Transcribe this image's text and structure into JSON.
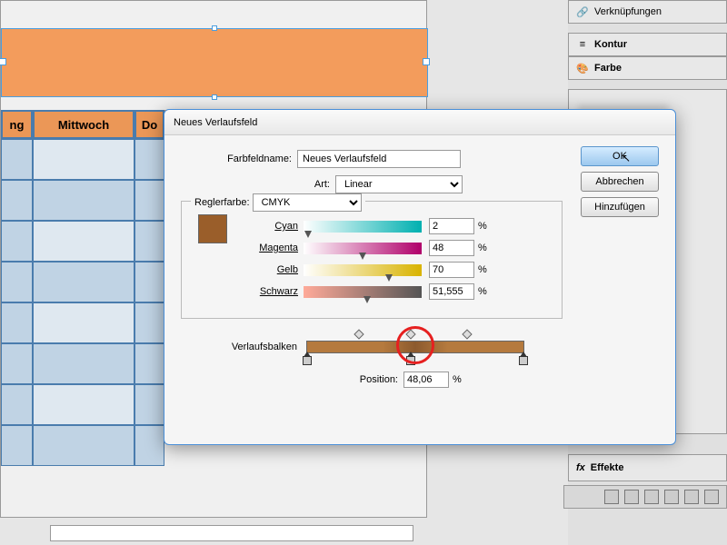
{
  "spreadsheet": {
    "headers": [
      "ng",
      "Mittwoch",
      "Do"
    ]
  },
  "right_panels": {
    "linked": "Verknüpfungen",
    "kontur": "Kontur",
    "farbe": "Farbe",
    "effekte": "Effekte",
    "fx_label": "fx"
  },
  "dialog": {
    "title": "Neues Verlaufsfeld",
    "name_label": "Farbfeldname:",
    "name_value": "Neues Verlaufsfeld",
    "type_label": "Art:",
    "type_value": "Linear",
    "regcolor_label": "Reglerfarbe:",
    "regcolor_value": "CMYK",
    "colors": {
      "cyan_label": "Cyan",
      "cyan_val": "2",
      "magenta_label": "Magenta",
      "magenta_val": "48",
      "yellow_label": "Gelb",
      "yellow_val": "70",
      "black_label": "Schwarz",
      "black_val": "51,555"
    },
    "pct": "%",
    "gradient_label": "Verlaufsbalken",
    "position_label": "Position:",
    "position_val": "48,06",
    "buttons": {
      "ok": "OK",
      "cancel": "Abbrechen",
      "add": "Hinzufügen"
    }
  }
}
